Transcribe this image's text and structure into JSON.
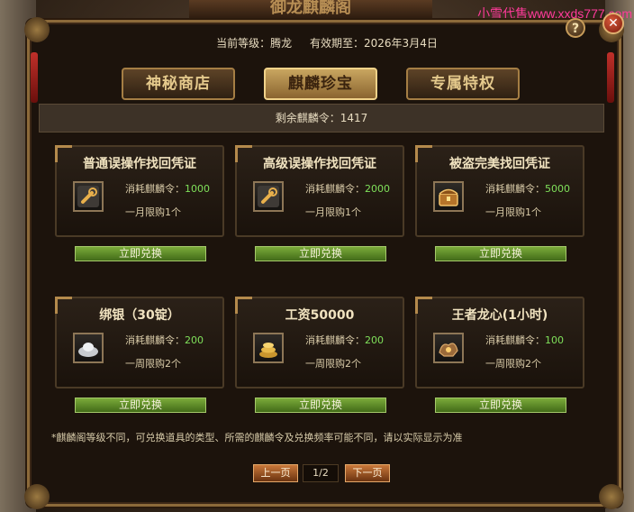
{
  "window": {
    "banner_title": "御龙麒麟阁",
    "watermark": "小雪代售www.xxds777.com"
  },
  "header": {
    "level_label": "当前等级：腾龙",
    "expiry_label": "有效期至：2026年3月4日",
    "help_glyph": "?",
    "close_glyph": "✕"
  },
  "tabs": [
    {
      "label": "神秘商店",
      "active": false
    },
    {
      "label": "麒麟珍宝",
      "active": true
    },
    {
      "label": "专属特权",
      "active": false
    }
  ],
  "remaining": "剩余麒麟令：1417",
  "items": [
    {
      "title": "普通误操作找回凭证",
      "cost_label": "消耗麒麟令：",
      "cost": "1000",
      "limit": "一月限购1个",
      "icon": "wrench-scroll-icon",
      "button": "立即兑换"
    },
    {
      "title": "高级误操作找回凭证",
      "cost_label": "消耗麒麟令：",
      "cost": "2000",
      "limit": "一月限购1个",
      "icon": "wrench-scroll-icon",
      "button": "立即兑换"
    },
    {
      "title": "被盗完美找回凭证",
      "cost_label": "消耗麒麟令：",
      "cost": "5000",
      "limit": "一月限购1个",
      "icon": "treasure-chest-icon",
      "button": "立即兑换"
    },
    {
      "title": "绑银（30锭）",
      "cost_label": "消耗麒麟令：",
      "cost": "200",
      "limit": "一周限购2个",
      "icon": "silver-ingot-icon",
      "button": "立即兑换"
    },
    {
      "title": "工资50000",
      "cost_label": "消耗麒麟令：",
      "cost": "200",
      "limit": "一周限购2个",
      "icon": "gold-coins-icon",
      "button": "立即兑换"
    },
    {
      "title": "王者龙心(1小时)",
      "cost_label": "消耗麒麟令：",
      "cost": "100",
      "limit": "一周限购2个",
      "icon": "dragon-heart-icon",
      "button": "立即兑换"
    }
  ],
  "note": "*麒麟阁等级不同，可兑换道具的类型、所需的麒麟令及兑换频率可能不同，请以实际显示为准",
  "pager": {
    "prev": "上一页",
    "page": "1/2",
    "next": "下一页"
  },
  "colors": {
    "accent_gold": "#b48a4c",
    "button_green": "#5f8c28",
    "cost_green": "#7fe05a",
    "pager_orange": "#b5622a"
  }
}
